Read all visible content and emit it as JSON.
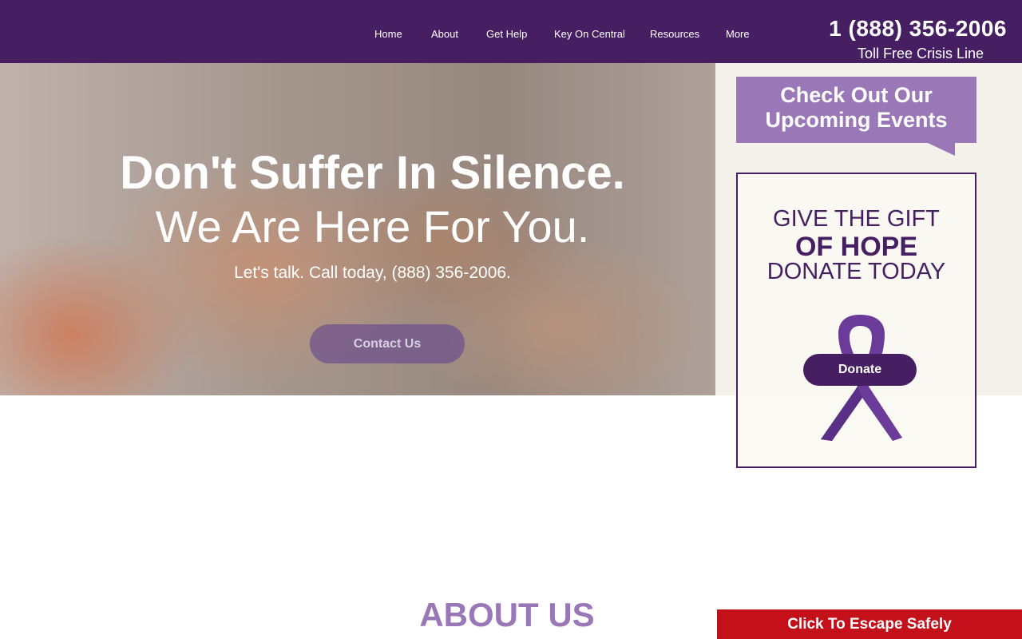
{
  "header": {
    "nav": [
      "Home",
      "About",
      "Get Help",
      "Key On Central",
      "Resources",
      "More"
    ],
    "phone": "1 (888) 356-2006",
    "phone_caption": "Toll Free Crisis Line"
  },
  "hero": {
    "title": "Don't Suffer In Silence.",
    "subtitle": "We Are Here For You.",
    "call_text": "Let's talk. Call today, (888) 356-2006.",
    "contact_label": "Contact Us"
  },
  "sidebar": {
    "events_line1": "Check Out Our",
    "events_line2": "Upcoming Events",
    "gift_line1": "GIVE THE GIFT",
    "gift_line2": "OF HOPE",
    "gift_line3": "DONATE TODAY",
    "donate_label": "Donate"
  },
  "about_heading": "ABOUT US",
  "escape_label": "Click To Escape Safely",
  "colors": {
    "brand_purple": "#461f63",
    "light_purple": "#9a78b8",
    "escape_red": "#c4101a"
  },
  "icons": {
    "ribbon": "awareness-ribbon-icon"
  }
}
